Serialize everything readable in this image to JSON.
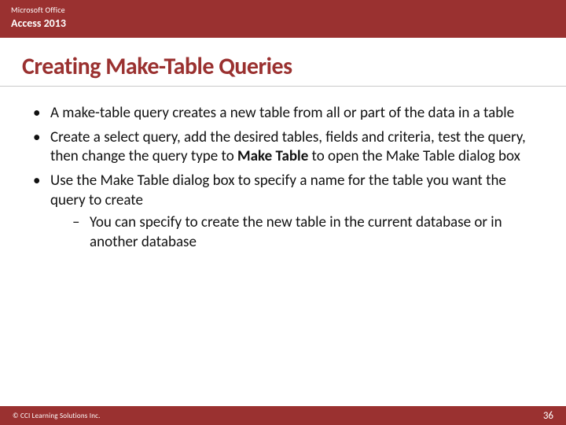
{
  "header": {
    "brand": "Microsoft Office",
    "product": "Access 2013"
  },
  "title": "Creating Make-Table Queries",
  "bullets": [
    {
      "pre": "A make-table query creates a new table from all or part of the data in a table",
      "bold": "",
      "post": ""
    },
    {
      "pre": "Create a select query, add the desired tables, fields and criteria, test the query, then change the query type to ",
      "bold": "Make Table",
      "post": " to open the Make Table dialog box"
    },
    {
      "pre": "Use the Make Table dialog box to specify a name for the table you want the query to create",
      "bold": "",
      "post": ""
    }
  ],
  "subbullets": [
    "You can specify to create the new table in the current database or in another database"
  ],
  "footer": {
    "copyright": "© CCI Learning Solutions Inc.",
    "page": "36"
  }
}
